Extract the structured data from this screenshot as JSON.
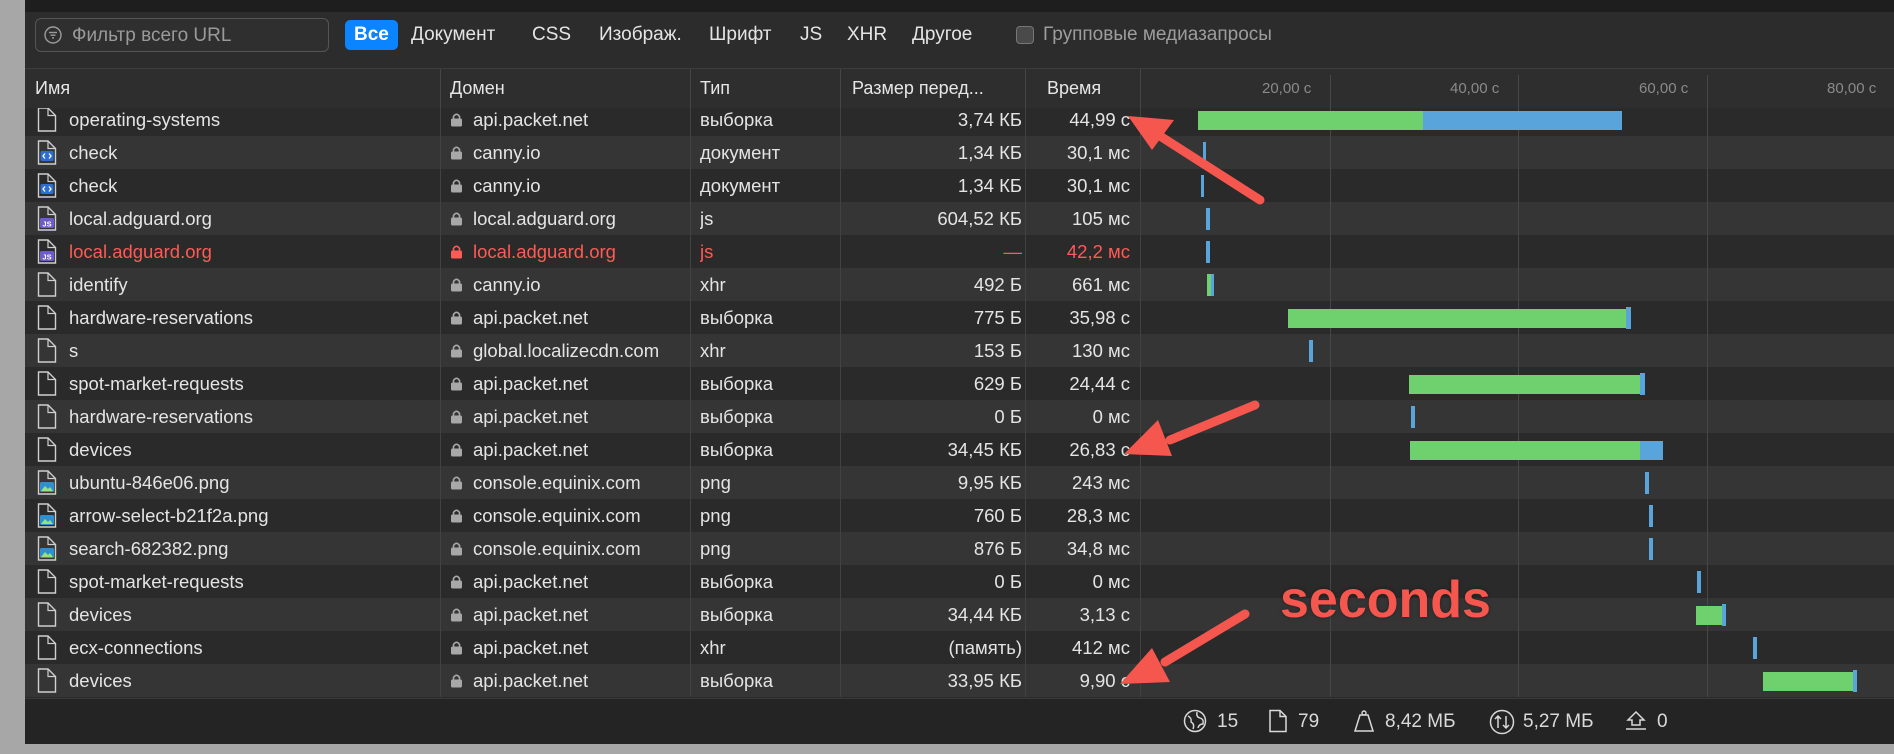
{
  "toolbar": {
    "search_placeholder": "Фильтр всего URL",
    "filters": [
      {
        "label": "Все",
        "active": true
      },
      {
        "label": "Документ",
        "active": false
      },
      {
        "label": "CSS",
        "active": false
      },
      {
        "label": "Изображ.",
        "active": false
      },
      {
        "label": "Шрифт",
        "active": false
      },
      {
        "label": "JS",
        "active": false
      },
      {
        "label": "XHR",
        "active": false
      },
      {
        "label": "Другое",
        "active": false
      }
    ],
    "group_media_label": "Групповые медиазапросы",
    "group_media_checked": false
  },
  "columns": {
    "name": "Имя",
    "domain": "Домен",
    "type": "Тип",
    "size": "Размер перед...",
    "time": "Время"
  },
  "timeline_ticks": [
    "20,00 с",
    "40,00 с",
    "60,00 с",
    "80,00 с"
  ],
  "rows": [
    {
      "name": "operating-systems",
      "domain": "api.packet.net",
      "type": "выборка",
      "size": "3,74 КБ",
      "time": "44,99 с",
      "icon": "file-icon",
      "error": false
    },
    {
      "name": "check",
      "domain": "canny.io",
      "type": "документ",
      "size": "1,34 КБ",
      "time": "30,1 мс",
      "icon": "document-code-icon",
      "error": false
    },
    {
      "name": "check",
      "domain": "canny.io",
      "type": "документ",
      "size": "1,34 КБ",
      "time": "30,1 мс",
      "icon": "document-code-icon",
      "error": false
    },
    {
      "name": "local.adguard.org",
      "domain": "local.adguard.org",
      "type": "js",
      "size": "604,52 КБ",
      "time": "105 мс",
      "icon": "js-file-icon",
      "error": false
    },
    {
      "name": "local.adguard.org",
      "domain": "local.adguard.org",
      "type": "js",
      "size": "—",
      "time": "42,2 мс",
      "icon": "js-file-icon",
      "error": true
    },
    {
      "name": "identify",
      "domain": "canny.io",
      "type": "xhr",
      "size": "492 Б",
      "time": "661 мс",
      "icon": "file-icon",
      "error": false
    },
    {
      "name": "hardware-reservations",
      "domain": "api.packet.net",
      "type": "выборка",
      "size": "775 Б",
      "time": "35,98 с",
      "icon": "file-icon",
      "error": false
    },
    {
      "name": "s",
      "domain": "global.localizecdn.com",
      "type": "xhr",
      "size": "153 Б",
      "time": "130 мс",
      "icon": "file-icon",
      "error": false
    },
    {
      "name": "spot-market-requests",
      "domain": "api.packet.net",
      "type": "выборка",
      "size": "629 Б",
      "time": "24,44 с",
      "icon": "file-icon",
      "error": false
    },
    {
      "name": "hardware-reservations",
      "domain": "api.packet.net",
      "type": "выборка",
      "size": "0 Б",
      "time": "0 мс",
      "icon": "file-icon",
      "error": false
    },
    {
      "name": "devices",
      "domain": "api.packet.net",
      "type": "выборка",
      "size": "34,45 КБ",
      "time": "26,83 с",
      "icon": "file-icon",
      "error": false
    },
    {
      "name": "ubuntu-846e06.png",
      "domain": "console.equinix.com",
      "type": "png",
      "size": "9,95 КБ",
      "time": "243 мс",
      "icon": "image-file-icon",
      "error": false
    },
    {
      "name": "arrow-select-b21f2a.png",
      "domain": "console.equinix.com",
      "type": "png",
      "size": "760 Б",
      "time": "28,3 мс",
      "icon": "image-file-icon",
      "error": false
    },
    {
      "name": "search-682382.png",
      "domain": "console.equinix.com",
      "type": "png",
      "size": "876 Б",
      "time": "34,8 мс",
      "icon": "image-file-icon",
      "error": false
    },
    {
      "name": "spot-market-requests",
      "domain": "api.packet.net",
      "type": "выборка",
      "size": "0 Б",
      "time": "0 мс",
      "icon": "file-icon",
      "error": false
    },
    {
      "name": "devices",
      "domain": "api.packet.net",
      "type": "выборка",
      "size": "34,44 КБ",
      "time": "3,13 с",
      "icon": "file-icon",
      "error": false
    },
    {
      "name": "ecx-connections",
      "domain": "api.packet.net",
      "type": "xhr",
      "size": "(память)",
      "time": "412 мс",
      "icon": "file-icon",
      "error": false
    },
    {
      "name": "devices",
      "domain": "api.packet.net",
      "type": "выборка",
      "size": "33,95 КБ",
      "time": "9,90 с",
      "icon": "file-icon",
      "error": false
    }
  ],
  "footer": {
    "domains": "15",
    "resources": "79",
    "size": "8,42 МБ",
    "transferred": "5,27 МБ",
    "redirects": "0"
  },
  "annotation": {
    "label": "seconds"
  },
  "colors": {
    "waiting": "#6fd16d",
    "receiving": "#5aa4dc",
    "accent": "#0a84ff",
    "error": "#ff5a55",
    "annotation": "#f5574f"
  }
}
